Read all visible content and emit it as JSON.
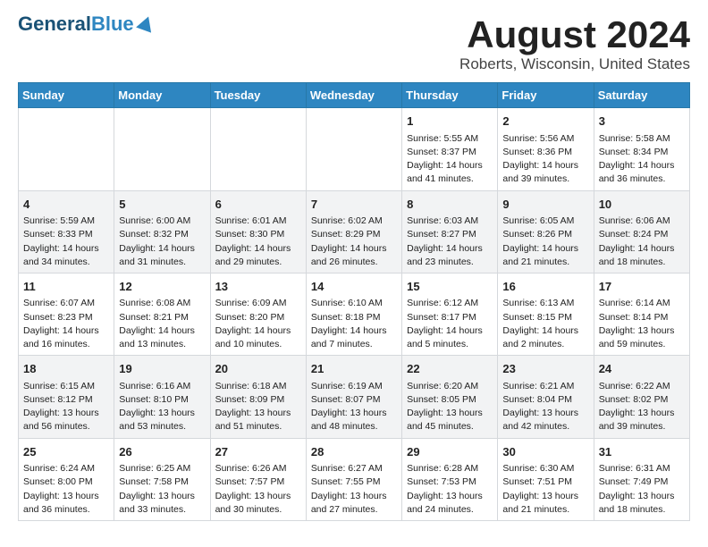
{
  "header": {
    "logo_line1": "General",
    "logo_line2": "Blue",
    "main_title": "August 2024",
    "subtitle": "Roberts, Wisconsin, United States"
  },
  "days_of_week": [
    "Sunday",
    "Monday",
    "Tuesday",
    "Wednesday",
    "Thursday",
    "Friday",
    "Saturday"
  ],
  "weeks": [
    [
      {
        "day": "",
        "content": ""
      },
      {
        "day": "",
        "content": ""
      },
      {
        "day": "",
        "content": ""
      },
      {
        "day": "",
        "content": ""
      },
      {
        "day": "1",
        "content": "Sunrise: 5:55 AM\nSunset: 8:37 PM\nDaylight: 14 hours\nand 41 minutes."
      },
      {
        "day": "2",
        "content": "Sunrise: 5:56 AM\nSunset: 8:36 PM\nDaylight: 14 hours\nand 39 minutes."
      },
      {
        "day": "3",
        "content": "Sunrise: 5:58 AM\nSunset: 8:34 PM\nDaylight: 14 hours\nand 36 minutes."
      }
    ],
    [
      {
        "day": "4",
        "content": "Sunrise: 5:59 AM\nSunset: 8:33 PM\nDaylight: 14 hours\nand 34 minutes."
      },
      {
        "day": "5",
        "content": "Sunrise: 6:00 AM\nSunset: 8:32 PM\nDaylight: 14 hours\nand 31 minutes."
      },
      {
        "day": "6",
        "content": "Sunrise: 6:01 AM\nSunset: 8:30 PM\nDaylight: 14 hours\nand 29 minutes."
      },
      {
        "day": "7",
        "content": "Sunrise: 6:02 AM\nSunset: 8:29 PM\nDaylight: 14 hours\nand 26 minutes."
      },
      {
        "day": "8",
        "content": "Sunrise: 6:03 AM\nSunset: 8:27 PM\nDaylight: 14 hours\nand 23 minutes."
      },
      {
        "day": "9",
        "content": "Sunrise: 6:05 AM\nSunset: 8:26 PM\nDaylight: 14 hours\nand 21 minutes."
      },
      {
        "day": "10",
        "content": "Sunrise: 6:06 AM\nSunset: 8:24 PM\nDaylight: 14 hours\nand 18 minutes."
      }
    ],
    [
      {
        "day": "11",
        "content": "Sunrise: 6:07 AM\nSunset: 8:23 PM\nDaylight: 14 hours\nand 16 minutes."
      },
      {
        "day": "12",
        "content": "Sunrise: 6:08 AM\nSunset: 8:21 PM\nDaylight: 14 hours\nand 13 minutes."
      },
      {
        "day": "13",
        "content": "Sunrise: 6:09 AM\nSunset: 8:20 PM\nDaylight: 14 hours\nand 10 minutes."
      },
      {
        "day": "14",
        "content": "Sunrise: 6:10 AM\nSunset: 8:18 PM\nDaylight: 14 hours\nand 7 minutes."
      },
      {
        "day": "15",
        "content": "Sunrise: 6:12 AM\nSunset: 8:17 PM\nDaylight: 14 hours\nand 5 minutes."
      },
      {
        "day": "16",
        "content": "Sunrise: 6:13 AM\nSunset: 8:15 PM\nDaylight: 14 hours\nand 2 minutes."
      },
      {
        "day": "17",
        "content": "Sunrise: 6:14 AM\nSunset: 8:14 PM\nDaylight: 13 hours\nand 59 minutes."
      }
    ],
    [
      {
        "day": "18",
        "content": "Sunrise: 6:15 AM\nSunset: 8:12 PM\nDaylight: 13 hours\nand 56 minutes."
      },
      {
        "day": "19",
        "content": "Sunrise: 6:16 AM\nSunset: 8:10 PM\nDaylight: 13 hours\nand 53 minutes."
      },
      {
        "day": "20",
        "content": "Sunrise: 6:18 AM\nSunset: 8:09 PM\nDaylight: 13 hours\nand 51 minutes."
      },
      {
        "day": "21",
        "content": "Sunrise: 6:19 AM\nSunset: 8:07 PM\nDaylight: 13 hours\nand 48 minutes."
      },
      {
        "day": "22",
        "content": "Sunrise: 6:20 AM\nSunset: 8:05 PM\nDaylight: 13 hours\nand 45 minutes."
      },
      {
        "day": "23",
        "content": "Sunrise: 6:21 AM\nSunset: 8:04 PM\nDaylight: 13 hours\nand 42 minutes."
      },
      {
        "day": "24",
        "content": "Sunrise: 6:22 AM\nSunset: 8:02 PM\nDaylight: 13 hours\nand 39 minutes."
      }
    ],
    [
      {
        "day": "25",
        "content": "Sunrise: 6:24 AM\nSunset: 8:00 PM\nDaylight: 13 hours\nand 36 minutes."
      },
      {
        "day": "26",
        "content": "Sunrise: 6:25 AM\nSunset: 7:58 PM\nDaylight: 13 hours\nand 33 minutes."
      },
      {
        "day": "27",
        "content": "Sunrise: 6:26 AM\nSunset: 7:57 PM\nDaylight: 13 hours\nand 30 minutes."
      },
      {
        "day": "28",
        "content": "Sunrise: 6:27 AM\nSunset: 7:55 PM\nDaylight: 13 hours\nand 27 minutes."
      },
      {
        "day": "29",
        "content": "Sunrise: 6:28 AM\nSunset: 7:53 PM\nDaylight: 13 hours\nand 24 minutes."
      },
      {
        "day": "30",
        "content": "Sunrise: 6:30 AM\nSunset: 7:51 PM\nDaylight: 13 hours\nand 21 minutes."
      },
      {
        "day": "31",
        "content": "Sunrise: 6:31 AM\nSunset: 7:49 PM\nDaylight: 13 hours\nand 18 minutes."
      }
    ]
  ]
}
